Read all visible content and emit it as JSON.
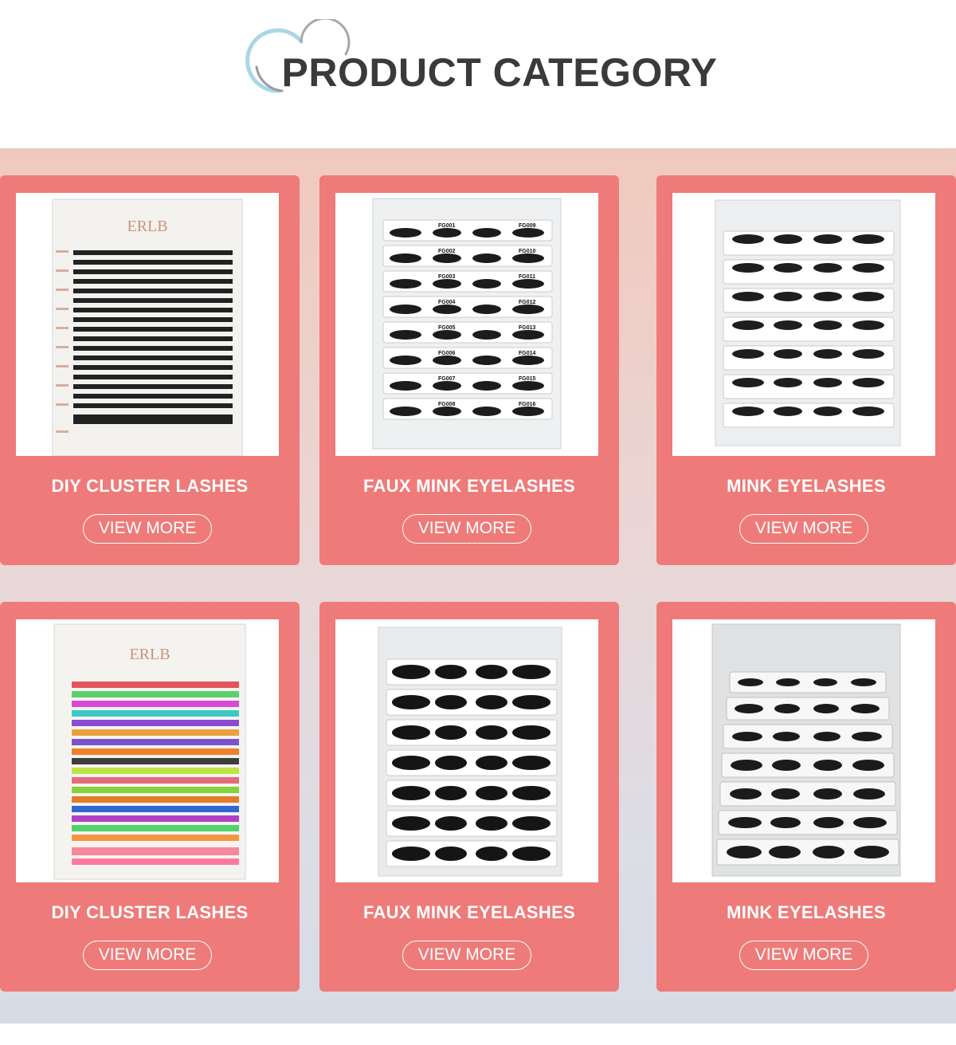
{
  "header": {
    "title": "PRODUCT CATEGORY"
  },
  "products": [
    {
      "title": "DIY CLUSTER LASHES",
      "button_label": "VIEW MORE",
      "image": "diy-cluster-lash-tray-photo",
      "brand": "ERLB"
    },
    {
      "title": "FAUX MINK EYELASHES",
      "button_label": "VIEW MORE",
      "image": "faux-mink-lash-tray-photo",
      "tray_labels": [
        "FG001",
        "FG002",
        "FG003",
        "FG004",
        "FG005",
        "FG006",
        "FG007",
        "FG008",
        "FG009",
        "FG010",
        "FG011",
        "FG012",
        "FG013",
        "FG014",
        "FG015",
        "FG016"
      ]
    },
    {
      "title": "MINK EYELASHES",
      "button_label": "VIEW MORE",
      "image": "mink-lash-tray-photo"
    },
    {
      "title": "DIY CLUSTER LASHES",
      "button_label": "VIEW MORE",
      "image": "colored-diy-cluster-lash-tray-photo",
      "brand": "ERLB"
    },
    {
      "title": "FAUX MINK EYELASHES",
      "button_label": "VIEW MORE",
      "image": "faux-mink-lash-tray-photo"
    },
    {
      "title": "MINK EYELASHES",
      "button_label": "VIEW MORE",
      "image": "mink-lash-tray-photo"
    }
  ],
  "colors": {
    "card": "#ee7b79",
    "title_text": "#3a3a3a",
    "band_top": "#f0c9bd",
    "band_bottom": "#d6dce6"
  }
}
